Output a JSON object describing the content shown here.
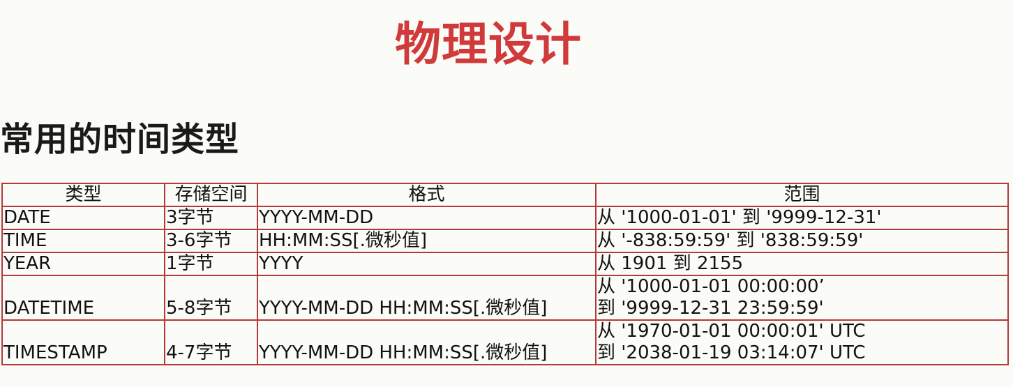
{
  "slide": {
    "title": "物理设计",
    "heading": "常用的时间类型"
  },
  "table": {
    "headers": [
      "类型",
      "存储空间",
      "格式",
      "范围"
    ],
    "rows": [
      {
        "type": "DATE",
        "storage": "3字节",
        "format": "YYYY-MM-DD",
        "range": [
          "从 '1000-01-01' 到  '9999-12-31'"
        ]
      },
      {
        "type": "TIME",
        "storage": "3-6字节",
        "format": "HH:MM:SS[.微秒值]",
        "range": [
          "从 '-838:59:59'  到  '838:59:59'"
        ]
      },
      {
        "type": "YEAR",
        "storage": "1字节",
        "format": "YYYY",
        "range": [
          "从 1901 到 2155"
        ]
      },
      {
        "type": "DATETIME",
        "storage": "5-8字节",
        "format": "YYYY-MM-DD HH:MM:SS[.微秒值]",
        "range": [
          "从 '1000-01-01 00:00:00’",
          "到 '9999-12-31 23:59:59'"
        ]
      },
      {
        "type": "TIMESTAMP",
        "storage": "4-7字节",
        "format": "YYYY-MM-DD HH:MM:SS[.微秒值]",
        "range": [
          "从 '1970-01-01 00:00:01' UTC",
          "到  '2038-01-19 03:14:07' UTC"
        ]
      }
    ]
  },
  "colors": {
    "title": "#d03a3a",
    "table_border": "#b23a3a",
    "background": "#fbfbf8"
  }
}
